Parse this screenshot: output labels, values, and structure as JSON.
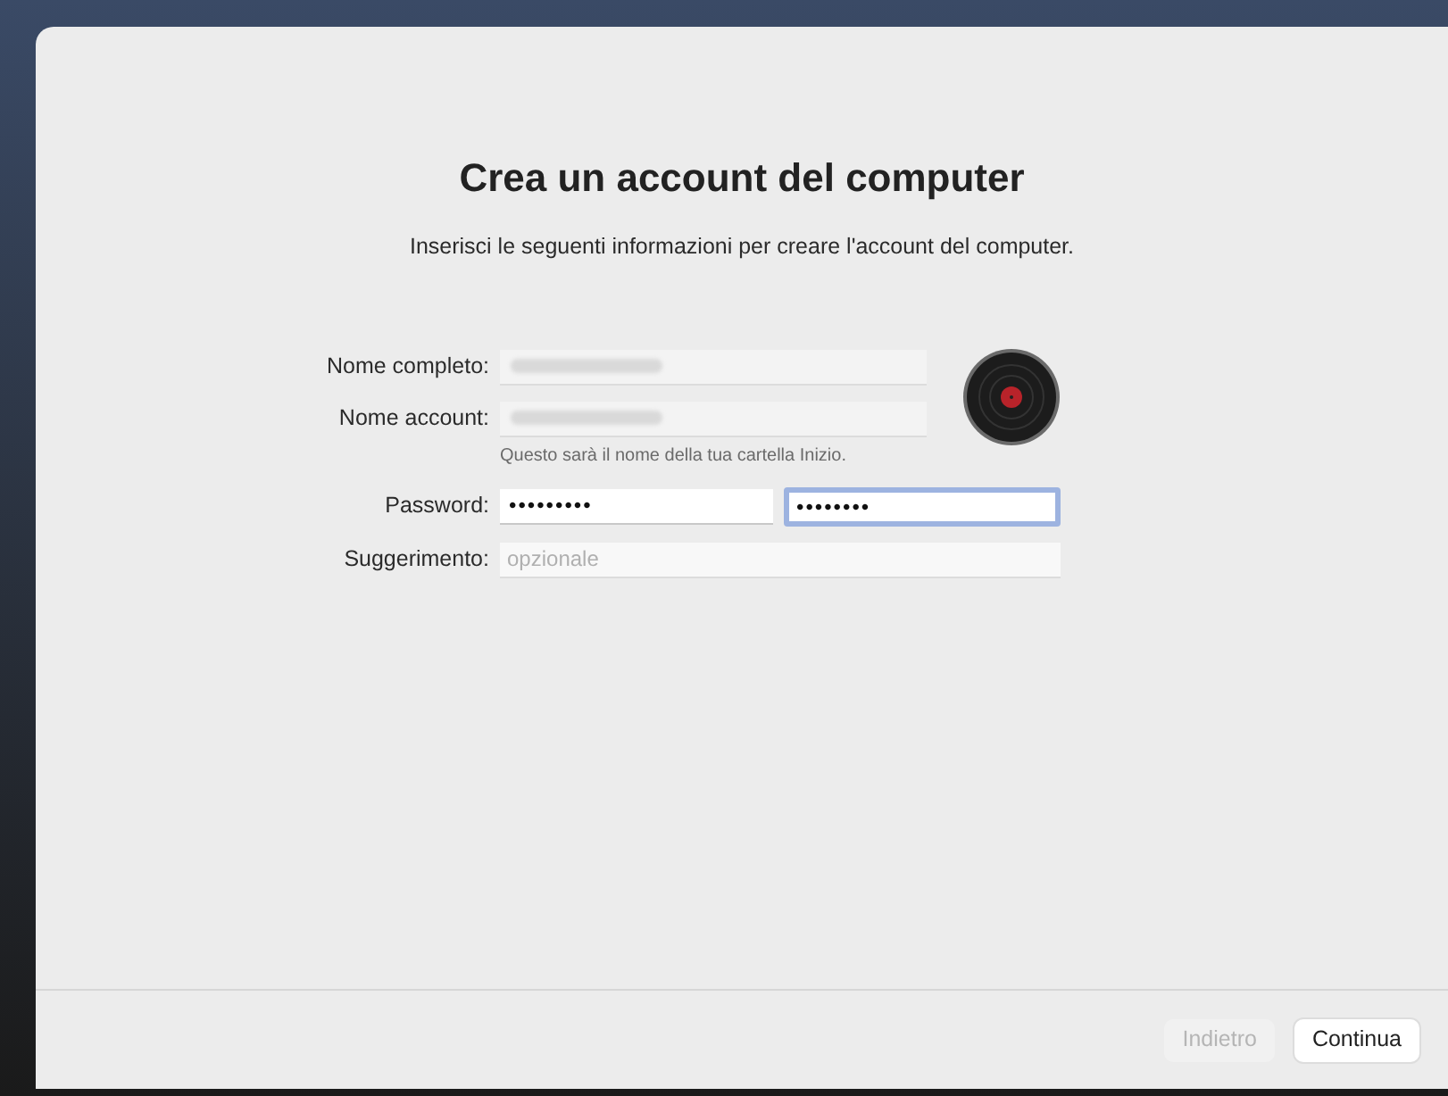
{
  "title": "Crea un account del computer",
  "subtitle": "Inserisci le seguenti informazioni per creare l'account del computer.",
  "fields": [
    {
      "label": "Nome completo:",
      "redacted": true
    },
    {
      "label": "Nome account:",
      "redacted": true,
      "hint": "Questo sarà il nome della tua cartella Inizio."
    }
  ],
  "password": {
    "label": "Password:",
    "value": "•••••••••",
    "verify_value": "••••••••",
    "verify_focused": true
  },
  "suggestion": {
    "label": "Suggerimento:",
    "placeholder": "opzionale"
  },
  "buttons": [
    {
      "label": "Indietro",
      "disabled": true
    },
    {
      "label": "Continua",
      "disabled": false
    }
  ]
}
